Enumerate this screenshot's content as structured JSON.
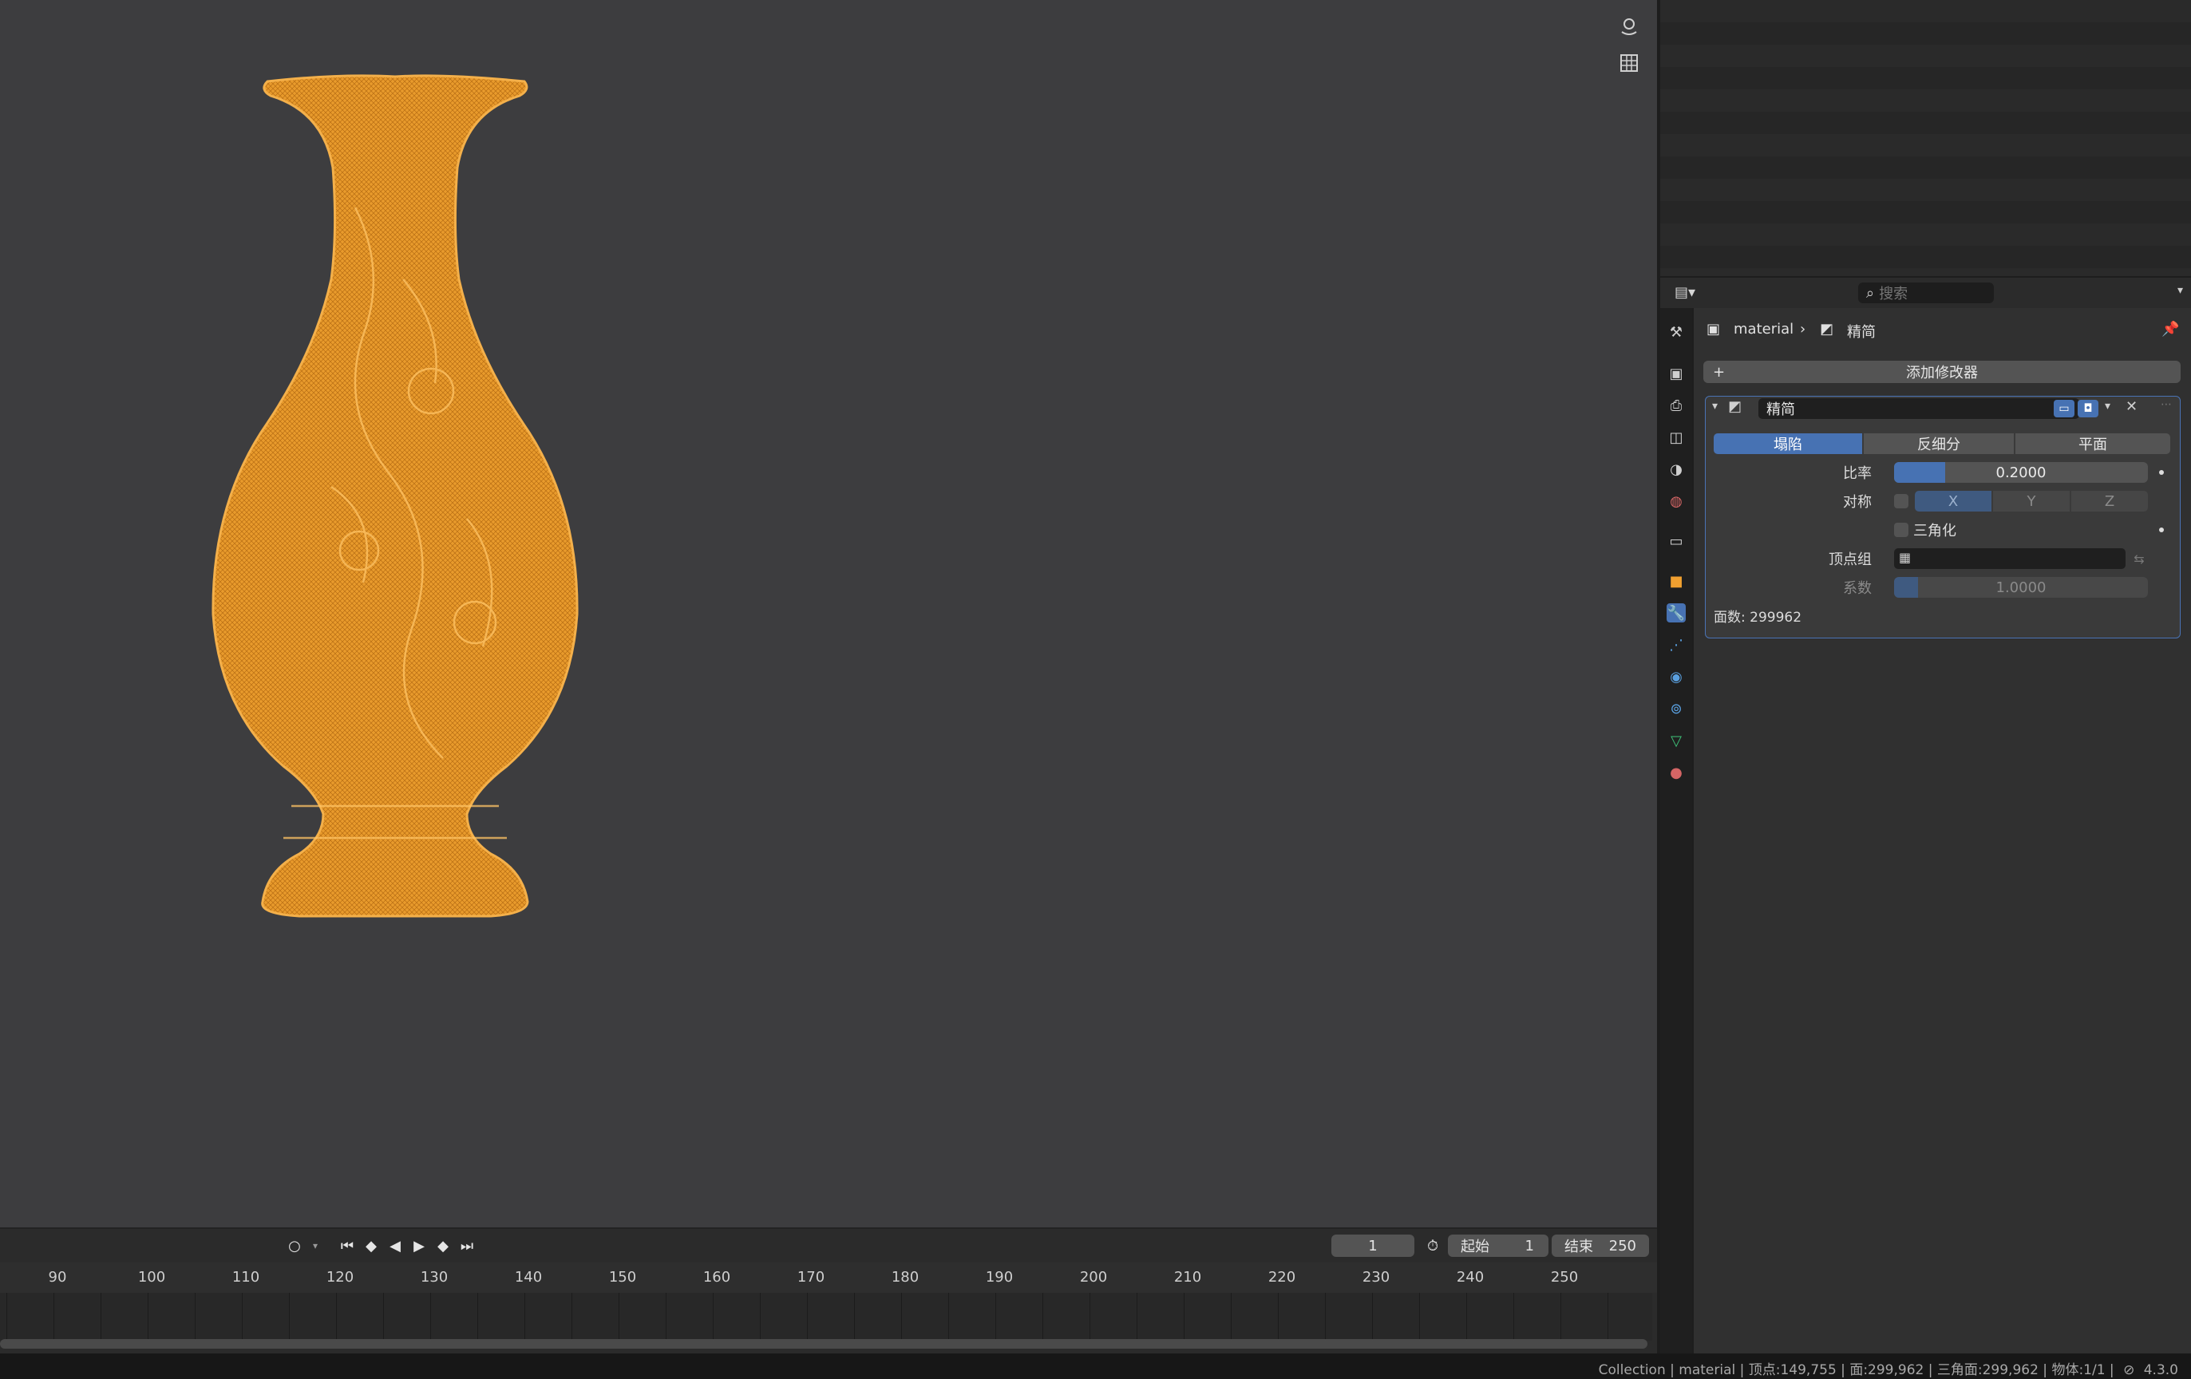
{
  "viewport": {
    "gizmo_buttons": [
      "camera-orbit-icon",
      "grid-view-icon"
    ]
  },
  "timeline": {
    "current_frame": "1",
    "start_label": "起始",
    "start_value": "1",
    "end_label": "结束",
    "end_value": "250",
    "ruler_ticks": [
      "90",
      "100",
      "110",
      "120",
      "130",
      "140",
      "150",
      "160",
      "170",
      "180",
      "190",
      "200",
      "210",
      "220",
      "230",
      "240",
      "250"
    ]
  },
  "statusbar": {
    "text": "Collection | material | 顶点:149,755 | 面:299,962 | 三角面:299,962 | 物体:1/1 |",
    "version": "4.3.0"
  },
  "properties": {
    "search_placeholder": "搜索",
    "breadcrumb_object": "material",
    "breadcrumb_modifier": "精简",
    "add_modifier_label": "添加修改器",
    "modifier": {
      "name": "精简",
      "modes": [
        "塌陷",
        "反细分",
        "平面"
      ],
      "active_mode": "塌陷",
      "ratio_label": "比率",
      "ratio_value": "0.2000",
      "ratio_fraction": 0.2,
      "symmetry_label": "对称",
      "axes": [
        "X",
        "Y",
        "Z"
      ],
      "triangulate_label": "三角化",
      "vertex_group_label": "顶点组",
      "factor_label": "系数",
      "factor_value": "1.0000",
      "face_count": "面数: 299962"
    }
  },
  "colors": {
    "accent": "#4772b3",
    "vase_orange": "#f0a030",
    "viewport_bg": "#3d3d3f"
  }
}
